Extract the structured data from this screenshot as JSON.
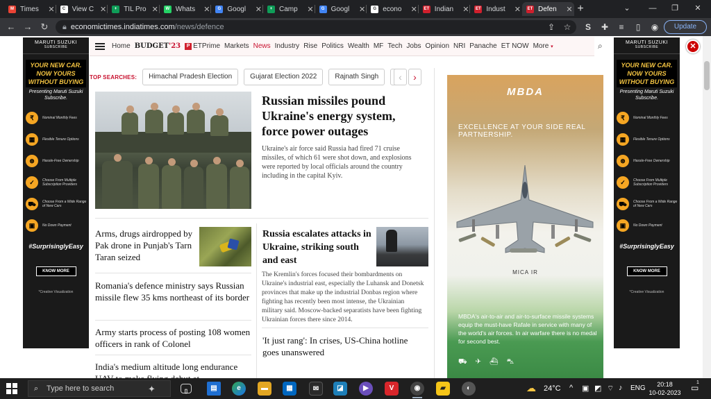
{
  "browser": {
    "tabs": [
      {
        "title": "Times",
        "fav": "M",
        "fav_color": "#ea4335"
      },
      {
        "title": "View C",
        "fav": "C",
        "fav_color": "#ffffff"
      },
      {
        "title": "TIL Pro",
        "fav": "+",
        "fav_color": "#0f9d58"
      },
      {
        "title": "Whats",
        "fav": "W",
        "fav_color": "#25d366"
      },
      {
        "title": "Googl",
        "fav": "G",
        "fav_color": "#4285f4"
      },
      {
        "title": "Camp",
        "fav": "+",
        "fav_color": "#0f9d58"
      },
      {
        "title": "Googl",
        "fav": "G",
        "fav_color": "#4285f4"
      },
      {
        "title": "econo",
        "fav": "G",
        "fav_color": "#ffffff"
      },
      {
        "title": "Indian",
        "fav": "ET",
        "fav_color": "#d0202d"
      },
      {
        "title": "Indust",
        "fav": "ET",
        "fav_color": "#d0202d"
      },
      {
        "title": "Defen",
        "fav": "ET",
        "fav_color": "#d0202d"
      }
    ],
    "url_domain": "economictimes.indiatimes.com",
    "url_path": "/news/defence",
    "update_label": "Update"
  },
  "nav": {
    "items": [
      "Home",
      "ETPrime",
      "Markets",
      "News",
      "Industry",
      "Rise",
      "Politics",
      "Wealth",
      "MF",
      "Tech",
      "Jobs",
      "Opinion",
      "NRI",
      "Panache",
      "ET NOW"
    ],
    "budget_a": "BUDGET",
    "budget_b": "'23",
    "more": "More",
    "active": "News"
  },
  "top_searches": {
    "label": "TOP SEARCHES:",
    "chips": [
      "Himachal Pradesh Election",
      "Gujarat Election 2022",
      "Rajnath Singh"
    ]
  },
  "lead": {
    "headline": "Russian missiles pound Ukraine's energy system, force power outages",
    "summary": "Ukraine's air force said Russia had fired 71 cruise missiles, of which 61 were shot down, and explosions were reported by local officials around the country including in the capital Kyiv."
  },
  "left_stories": [
    "Arms, drugs airdropped by Pak drone in Punjab's Tarn Taran seized",
    "Romania's defence ministry says Russian missile flew 35 kms northeast of its border",
    "Army starts process of posting 108 women officers in rank of Colonel",
    "India's medium altitude long endurance UAV to make flying debut at"
  ],
  "right_stories": {
    "headline": "Russia escalates attacks in Ukraine, striking south and east",
    "summary": "The Kremlin's forces focused their bombardments on Ukraine's industrial east, especially the Luhansk and Donetsk provinces that make up the industrial Donbas region where fighting has recently been most intense, the Ukrainian military said. Moscow-backed separatists have been fighting Ukrainian forces there since 2014.",
    "second": "'It just rang': In crises, US-China hotline goes unanswered"
  },
  "side_ad": {
    "brand": "MARUTI SUZUKI",
    "brand_sub": "SUBSCRIBE",
    "headline": "YOUR NEW CAR. NOW YOURS WITHOUT BUYING",
    "presenting": "Presenting Maruti Suzuki Subscribe.",
    "features": [
      "Nominal Monthly Fees",
      "Flexible Tenure Options",
      "Hassle-Free Ownership",
      "Choose From Multiple Subscription Providers",
      "Choose From a Wide Range of New Cars",
      "No Down Payment"
    ],
    "hashtag": "#SurprisinglyEasy",
    "cta": "KNOW MORE",
    "note": "*Creative Visualization"
  },
  "mbda_ad": {
    "logo": "MBDA",
    "tagline": "EXCELLENCE AT YOUR SIDE REAL PARTNERSHIP.",
    "product": "MICA IR",
    "body": "MBDA's air-to-air and air-to-surface missile systems equip the must-have Rafale in service with many of the world's air forces. In air warfare there is no medal for second best."
  },
  "taskbar": {
    "search_placeholder": "Type here to search",
    "weather": "24°C",
    "lang": "ENG",
    "time": "20:18",
    "date": "10-02-2023",
    "notif_count": "1"
  }
}
